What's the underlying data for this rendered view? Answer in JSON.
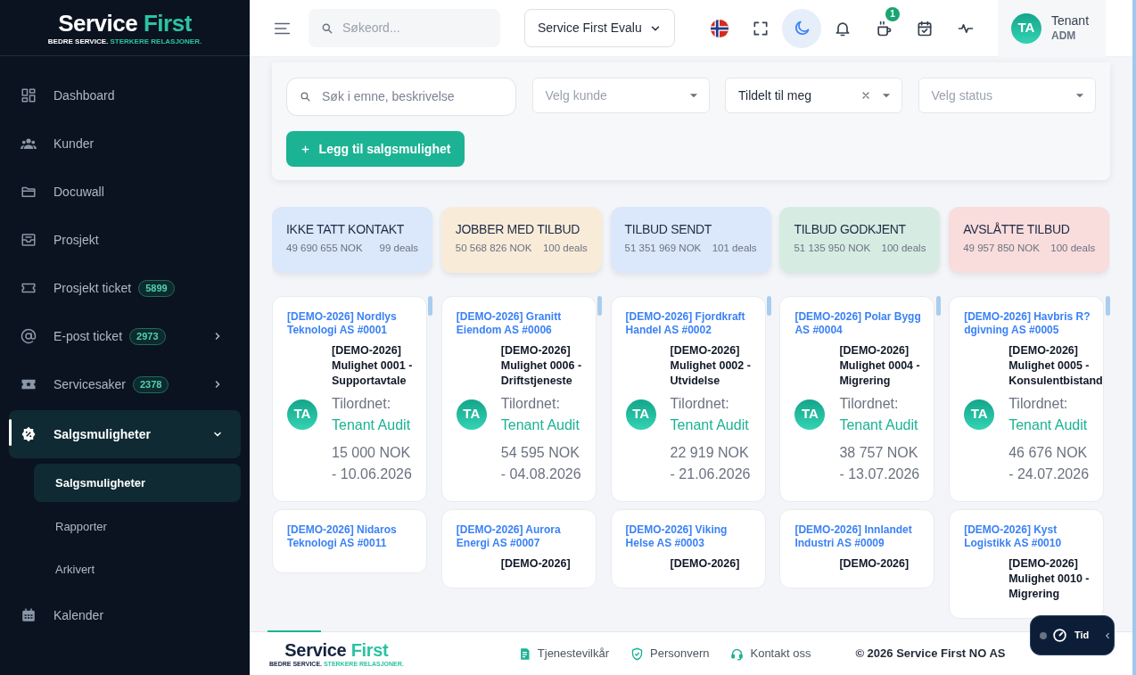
{
  "sidebar": {
    "logo": {
      "name_main": "Service",
      "name_accent": "First",
      "tagline_main": "BEDRE SERVICE.",
      "tagline_accent": "STERKERE RELASJONER."
    },
    "items": [
      {
        "kind": "link",
        "label": "Dashboard",
        "selected": false
      },
      {
        "kind": "link",
        "label": "Kunder",
        "selected": false
      },
      {
        "kind": "link",
        "label": "Docuwall",
        "selected": false
      },
      {
        "kind": "link",
        "label": "Prosjekt",
        "selected": false
      },
      {
        "kind": "link",
        "label": "Prosjekt ticket",
        "badge": "5899",
        "selected": false
      },
      {
        "kind": "group",
        "label": "E-post ticket",
        "badge": "2973",
        "expanded": false,
        "selected": false
      },
      {
        "kind": "group",
        "label": "Servicesaker",
        "badge": "2378",
        "expanded": false,
        "selected": false
      },
      {
        "kind": "group",
        "label": "Salgsmuligheter",
        "expanded": true,
        "selected": true,
        "children": [
          {
            "label": "Salgsmuligheter",
            "selected": true
          },
          {
            "label": "Rapporter",
            "selected": false
          },
          {
            "label": "Arkivert",
            "selected": false
          }
        ]
      },
      {
        "kind": "link",
        "label": "Kalender",
        "selected": false
      }
    ]
  },
  "header": {
    "search": {
      "placeholder": "Søkeord..."
    },
    "workspace_select": {
      "value": "Service First Evalu"
    },
    "toolbar": [
      {
        "kind": "language",
        "active": false
      },
      {
        "kind": "fullscreen",
        "active": false
      },
      {
        "kind": "theme",
        "active": true
      },
      {
        "kind": "notifications",
        "active": false
      },
      {
        "kind": "break",
        "badge": "1",
        "active": false
      },
      {
        "kind": "calendar",
        "active": false
      },
      {
        "kind": "activity",
        "active": false
      }
    ],
    "user": {
      "initials": "TA",
      "name": "Tenant",
      "role": "ADM"
    }
  },
  "filters": {
    "search": {
      "placeholder": "Søk i emne, beskrivelse"
    },
    "selects": [
      {
        "placeholder": "Velg kunde"
      },
      {
        "value": "Tildelt til meg",
        "clearable": true
      },
      {
        "placeholder": "Velg status"
      }
    ],
    "add_button": {
      "label": "Legg til salgsmulighet"
    }
  },
  "stages": [
    {
      "title": "IKKE TATT KONTAKT",
      "amount": "49 690 655 NOK",
      "deals": "99 deals",
      "color": "#dbe7fb",
      "cards": [
        {
          "customer": "[DEMO-2026] Nordlys Teknologi AS #0001",
          "title": "[DEMO-2026] Mulighet 0001 - Supportavtale",
          "assigned_label": "Tilordnet:",
          "assignee": "Tenant Audit",
          "initials": "TA",
          "value": "15 000 NOK - 10.06.2026"
        },
        {
          "customer": "[DEMO-2026] Nidaros Teknologi AS #0011"
        }
      ]
    },
    {
      "title": "JOBBER MED TILBUD",
      "amount": "50 568 826 NOK",
      "deals": "100 deals",
      "color": "#f8ecd9",
      "cards": [
        {
          "customer": "[DEMO-2026] Granitt Eiendom AS #0006",
          "title": "[DEMO-2026] Mulighet 0006 - Driftstjeneste",
          "assigned_label": "Tilordnet:",
          "assignee": "Tenant Audit",
          "initials": "TA",
          "value": "54 595 NOK - 04.08.2026"
        },
        {
          "customer": "[DEMO-2026] Aurora Energi AS #0007",
          "title": "[DEMO-2026]"
        }
      ]
    },
    {
      "title": "TILBUD SENDT",
      "amount": "51 351 969 NOK",
      "deals": "101 deals",
      "color": "#dbe7fb",
      "cards": [
        {
          "customer": "[DEMO-2026] Fjordkraft Handel AS #0002",
          "title": "[DEMO-2026] Mulighet 0002 - Utvidelse",
          "assigned_label": "Tilordnet:",
          "assignee": "Tenant Audit",
          "initials": "TA",
          "value": "22 919 NOK - 21.06.2026"
        },
        {
          "customer": "[DEMO-2026] Viking Helse AS #0003",
          "title": "[DEMO-2026]"
        }
      ]
    },
    {
      "title": "TILBUD GODKJENT",
      "amount": "51 135 950 NOK",
      "deals": "100 deals",
      "color": "#d6ece2",
      "cards": [
        {
          "customer": "[DEMO-2026] Polar Bygg AS #0004",
          "title": "[DEMO-2026] Mulighet 0004 - Migrering",
          "assigned_label": "Tilordnet:",
          "assignee": "Tenant Audit",
          "initials": "TA",
          "value": "38 757 NOK - 13.07.2026"
        },
        {
          "customer": "[DEMO-2026] Innlandet Industri AS #0009",
          "title": "[DEMO-2026]"
        }
      ]
    },
    {
      "title": "AVSLÅTTE TILBUD",
      "amount": "49 957 850 NOK",
      "deals": "100 deals",
      "color": "#f9dcdc",
      "cards": [
        {
          "customer": "[DEMO-2026] Havbris R?dgivning AS #0005",
          "title": "[DEMO-2026] Mulighet 0005 - Konsulentbistand",
          "assigned_label": "Tilordnet:",
          "assignee": "Tenant Audit",
          "initials": "TA",
          "value": "46 676 NOK - 24.07.2026"
        },
        {
          "customer": "[DEMO-2026] Kyst Logistikk AS #0010",
          "title": "[DEMO-2026] Mulighet 0010 - Migrering"
        }
      ]
    }
  ],
  "footer": {
    "logo": {
      "name_main": "Service",
      "name_accent": "First",
      "tagline_main": "BEDRE SERVICE.",
      "tagline_accent": "STERKERE RELASJONER."
    },
    "links": [
      {
        "kind": "terms",
        "label": "Tjenestevilkår"
      },
      {
        "kind": "privacy",
        "label": "Personvern"
      },
      {
        "kind": "contact",
        "label": "Kontakt oss"
      }
    ],
    "copyright": "© 2026 Service First NO AS"
  },
  "timer": {
    "label": "Tid"
  }
}
